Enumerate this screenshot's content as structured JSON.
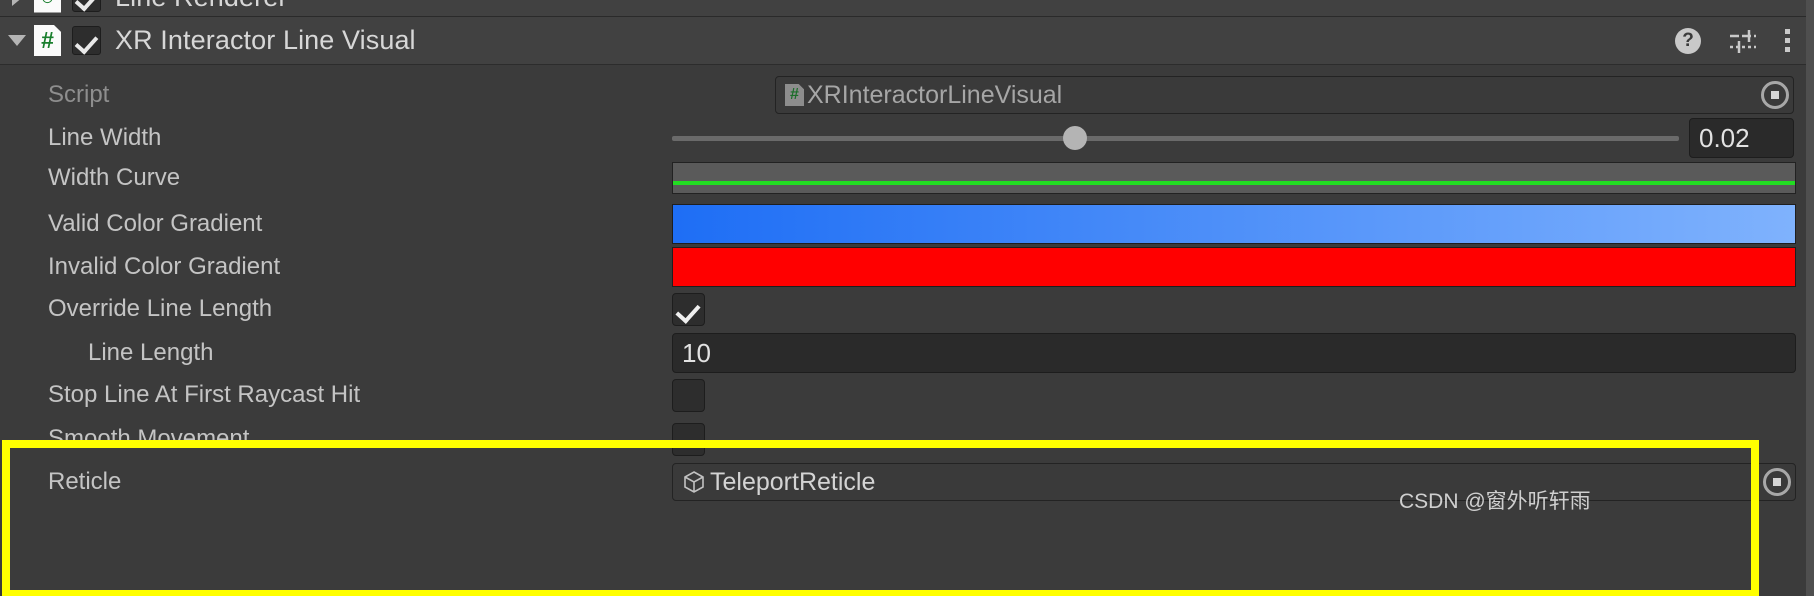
{
  "window": {
    "background": "#3b3b3b",
    "accent_highlight": "#ffff00"
  },
  "cut_component": {
    "title": "Line Renderer",
    "foldout_icon": "triangle-right-icon",
    "enabled": true
  },
  "component": {
    "title": "XR Interactor Line Visual",
    "foldout_icon": "triangle-down-icon",
    "script_icon": "csharp-script-icon",
    "script_icon_glyph": "#",
    "enabled": true,
    "help_icon": "help-icon",
    "help_glyph": "?",
    "presets_icon": "preset-sliders-icon",
    "menu_icon": "kebab-menu-icon"
  },
  "properties": [
    {
      "label": "Script",
      "type": "object",
      "value": "XRInteractorLineVisual",
      "icon": "csharp-script-icon",
      "icon_glyph": "#",
      "disabled": true,
      "has_picker": true
    },
    {
      "label": "Line Width",
      "type": "slider",
      "value": "0.02",
      "knob_percent": 40
    },
    {
      "label": "Width Curve",
      "type": "curve",
      "curve_color": "#22dd22"
    },
    {
      "label": "Valid Color Gradient",
      "type": "gradient",
      "from": "#1e6ef5",
      "to": "#7fb2fd"
    },
    {
      "label": "Invalid Color Gradient",
      "type": "gradient",
      "from": "#ff0000",
      "to": "#ff0000"
    },
    {
      "label": "Override Line Length",
      "type": "toggle",
      "checked": true
    },
    {
      "label": "Line Length",
      "type": "number",
      "value": "10",
      "indent": true
    },
    {
      "label": "Stop Line At First Raycast Hit",
      "type": "toggle",
      "checked": false
    },
    {
      "label": "Smooth Movement",
      "type": "toggle",
      "checked": false
    },
    {
      "label": "Reticle",
      "type": "object",
      "value": "TeleportReticle",
      "icon": "prefab-cube-icon",
      "disabled": false,
      "has_picker": true
    }
  ],
  "watermark": {
    "text": "CSDN @窗外听轩雨"
  }
}
